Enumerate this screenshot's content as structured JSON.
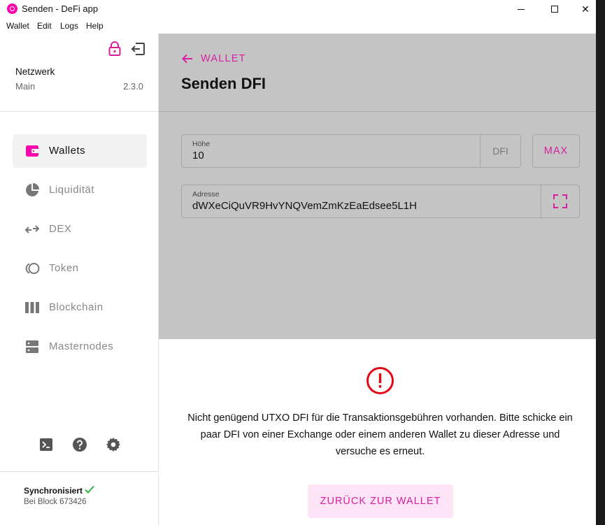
{
  "window": {
    "title": "Senden - DeFi app",
    "minimize_glyph": "—",
    "close_glyph": "✕"
  },
  "menu": {
    "items": [
      "Wallet",
      "Edit",
      "Logs",
      "Help"
    ]
  },
  "sidebar": {
    "network_title": "Netzwerk",
    "network_name": "Main",
    "version": "2.3.0",
    "nav": [
      {
        "label": "Wallets",
        "icon": "wallet-icon",
        "active": true
      },
      {
        "label": "Liquidität",
        "icon": "pie-chart-icon",
        "active": false
      },
      {
        "label": "DEX",
        "icon": "swap-icon",
        "active": false
      },
      {
        "label": "Token",
        "icon": "token-icon",
        "active": false
      },
      {
        "label": "Blockchain",
        "icon": "blockchain-icon",
        "active": false
      },
      {
        "label": "Masternodes",
        "icon": "server-icon",
        "active": false
      }
    ],
    "sync_status": "Synchronisiert",
    "sync_block": "Bei Block 673426"
  },
  "main": {
    "back_label": "WALLET",
    "title": "Senden DFI",
    "amount": {
      "label": "Höhe",
      "value": "10",
      "unit": "DFI"
    },
    "max_label": "MAX",
    "address": {
      "label": "Adresse",
      "value": "dWXeCiQuVR9HvYNQVemZmKzEaEdsee5L1H"
    },
    "error_message": "Nicht genügend UTXO DFI für die Transaktionsgebühren vorhanden. Bitte schicke ein paar DFI von einer Exchange oder einem anderen Wallet zu dieser Adresse und versuche es erneut.",
    "return_button": "ZURÜCK ZUR WALLET"
  },
  "colors": {
    "accent": "#d61f9f",
    "brand": "#ff00af",
    "error": "#e30613",
    "success": "#2fb344",
    "overlay": "#c4c4c4"
  }
}
